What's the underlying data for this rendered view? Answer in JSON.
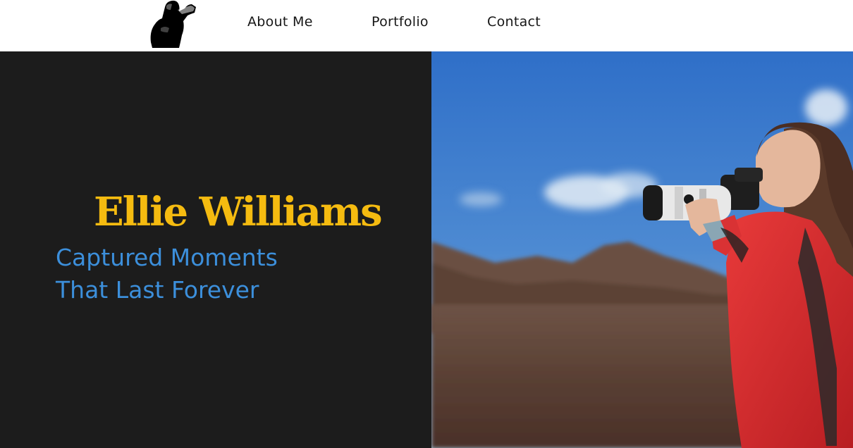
{
  "nav": {
    "items": [
      {
        "label": "About Me"
      },
      {
        "label": "Portfolio"
      },
      {
        "label": "Contact"
      }
    ]
  },
  "hero": {
    "name": "Ellie Williams",
    "tagline_line1": "Captured Moments",
    "tagline_line2": "That Last Forever"
  },
  "colors": {
    "name": "#f5bb10",
    "tagline": "#3c8fdb",
    "panel": "#1c1c1c",
    "nav_text": "#161616"
  },
  "icons": {
    "logo": "photographer-silhouette-logo"
  }
}
